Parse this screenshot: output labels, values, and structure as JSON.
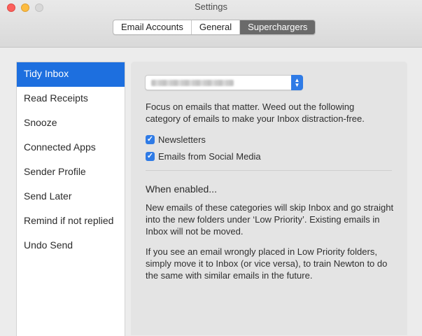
{
  "window": {
    "title": "Settings"
  },
  "tabs": [
    {
      "label": "Email Accounts"
    },
    {
      "label": "General"
    },
    {
      "label": "Superchargers"
    }
  ],
  "sidebar": {
    "items": [
      {
        "label": "Tidy Inbox"
      },
      {
        "label": "Read Receipts"
      },
      {
        "label": "Snooze"
      },
      {
        "label": "Connected Apps"
      },
      {
        "label": "Sender Profile"
      },
      {
        "label": "Send Later"
      },
      {
        "label": "Remind if not replied"
      },
      {
        "label": "Undo Send"
      }
    ],
    "selected": "Tidy Inbox"
  },
  "panel": {
    "account_select": {
      "value_visible": "blurred"
    },
    "description": "Focus on emails that matter. Weed out the following category of emails to make your Inbox distraction-free.",
    "checkboxes": [
      {
        "label": "Newsletters",
        "checked": true
      },
      {
        "label": "Emails from Social Media",
        "checked": true
      }
    ],
    "when_enabled_heading": "When enabled...",
    "paragraph_1": "New emails of these categories will skip Inbox and go straight into the new folders under ‘Low Priority’. Existing emails in Inbox will not be moved.",
    "paragraph_2": "If you see an email wrongly placed in Low Priority folders, simply move it to Inbox (or vice versa), to train Newton to do the same with similar emails in the future."
  },
  "colors": {
    "accent": "#1d6fdf",
    "checkbox": "#2f7be6",
    "active_tab": "#6a6a6a"
  }
}
